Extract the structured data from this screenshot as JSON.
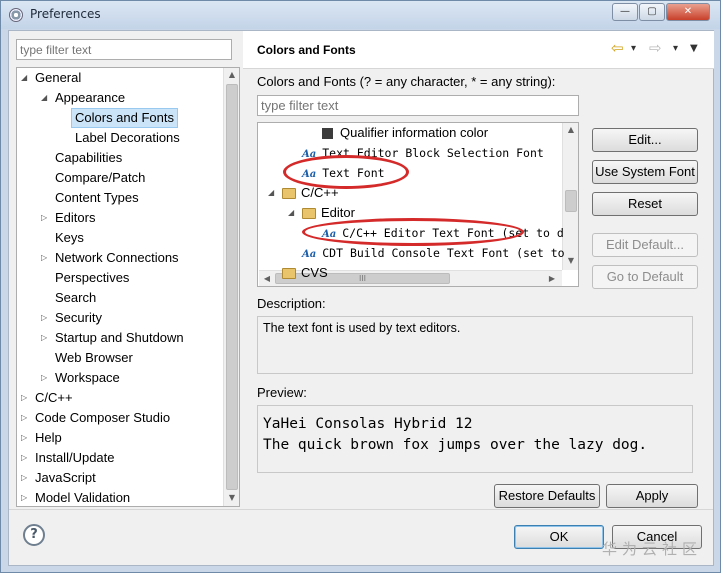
{
  "window": {
    "title": "Preferences",
    "controls": {
      "minimize": "—",
      "maximize": "▢",
      "close": "✕"
    }
  },
  "left": {
    "filter_placeholder": "type filter text",
    "tree": [
      {
        "label": "General",
        "level": 0,
        "toggle": "expanded"
      },
      {
        "label": "Appearance",
        "level": 1,
        "toggle": "expanded"
      },
      {
        "label": "Colors and Fonts",
        "level": 2,
        "toggle": "none",
        "selected": true
      },
      {
        "label": "Label Decorations",
        "level": 2,
        "toggle": "none"
      },
      {
        "label": "Capabilities",
        "level": 1,
        "toggle": "none"
      },
      {
        "label": "Compare/Patch",
        "level": 1,
        "toggle": "none"
      },
      {
        "label": "Content Types",
        "level": 1,
        "toggle": "none"
      },
      {
        "label": "Editors",
        "level": 1,
        "toggle": "collapsed"
      },
      {
        "label": "Keys",
        "level": 1,
        "toggle": "none"
      },
      {
        "label": "Network Connections",
        "level": 1,
        "toggle": "collapsed"
      },
      {
        "label": "Perspectives",
        "level": 1,
        "toggle": "none"
      },
      {
        "label": "Search",
        "level": 1,
        "toggle": "none"
      },
      {
        "label": "Security",
        "level": 1,
        "toggle": "collapsed"
      },
      {
        "label": "Startup and Shutdown",
        "level": 1,
        "toggle": "collapsed"
      },
      {
        "label": "Web Browser",
        "level": 1,
        "toggle": "none"
      },
      {
        "label": "Workspace",
        "level": 1,
        "toggle": "collapsed"
      },
      {
        "label": "C/C++",
        "level": 0,
        "toggle": "collapsed"
      },
      {
        "label": "Code Composer Studio",
        "level": 0,
        "toggle": "collapsed"
      },
      {
        "label": "Help",
        "level": 0,
        "toggle": "collapsed"
      },
      {
        "label": "Install/Update",
        "level": 0,
        "toggle": "collapsed"
      },
      {
        "label": "JavaScript",
        "level": 0,
        "toggle": "collapsed"
      },
      {
        "label": "Model Validation",
        "level": 0,
        "toggle": "collapsed"
      }
    ]
  },
  "right": {
    "header_title": "Colors and Fonts",
    "nav": {
      "back": "⇦",
      "forward": "⇨",
      "dropdown": "▾",
      "menu": "▼"
    },
    "subtitle": "Colors and Fonts (? = any character, * = any string):",
    "filter_placeholder": "type filter text",
    "font_tree": [
      {
        "label": "Qualifier information color",
        "type": "color",
        "level": 2
      },
      {
        "label": "Text Editor Block Selection Font",
        "type": "font",
        "level": 1
      },
      {
        "label": "Text Font",
        "type": "font",
        "level": 1
      },
      {
        "label": "C/C++",
        "type": "category",
        "level": 0,
        "toggle": "expanded"
      },
      {
        "label": "Editor",
        "type": "category",
        "level": 1,
        "toggle": "expanded"
      },
      {
        "label": "C/C++ Editor Text Font (set to d",
        "type": "font",
        "level": 2
      },
      {
        "label": "CDT Build Console Text Font (set to",
        "type": "font",
        "level": 1
      },
      {
        "label": "CVS",
        "type": "category",
        "level": 0
      }
    ],
    "hscroll_grip": "III",
    "buttons": {
      "edit": "Edit...",
      "use_system_font": "Use System Font",
      "reset": "Reset",
      "edit_default": "Edit Default...",
      "go_to_default": "Go to Default"
    },
    "description_label": "Description:",
    "description_text": "The text font is used by text editors.",
    "preview_label": "Preview:",
    "preview_lines": [
      "YaHei Consolas Hybrid 12",
      "The quick brown fox jumps over the lazy dog."
    ],
    "restore_defaults": "Restore Defaults",
    "apply": "Apply"
  },
  "footer": {
    "help_icon": "?",
    "ok": "OK",
    "cancel": "Cancel"
  },
  "watermark": "华为云社区",
  "colors": {
    "selection_bg": "#cce4f7",
    "annotation_red": "#d42a2a",
    "icon_blue": "#1d5fa8"
  }
}
